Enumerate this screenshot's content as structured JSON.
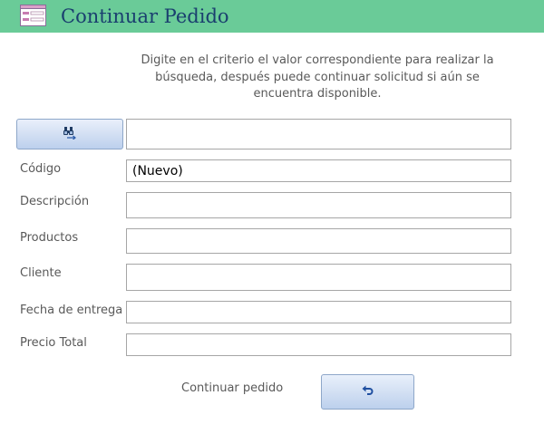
{
  "header": {
    "title": "Continuar Pedido",
    "form_icon": "form-icon",
    "background": "#6acb98"
  },
  "instructions": "Digite en el criterio el valor correspondiente para realizar la búsqueda, después puede continuar solicitud si aún se encuentra disponible.",
  "search": {
    "button_icon": "binoculars-icon",
    "criteria_value": ""
  },
  "fields": {
    "codigo": {
      "label": "Código",
      "value": "(Nuevo)"
    },
    "descripcion": {
      "label": "Descripción",
      "value": ""
    },
    "productos": {
      "label": "Productos",
      "value": ""
    },
    "cliente": {
      "label": "Cliente",
      "value": ""
    },
    "fecha_entrega": {
      "label": "Fecha de entrega",
      "value": ""
    },
    "precio_total": {
      "label": "Precio Total",
      "value": ""
    }
  },
  "footer": {
    "continue_label": "Continuar pedido",
    "button_icon": "undo-icon"
  },
  "colors": {
    "title_text": "#1a3f6f",
    "button_gradient_end": "#bcd0ed",
    "label_text": "#595959"
  }
}
